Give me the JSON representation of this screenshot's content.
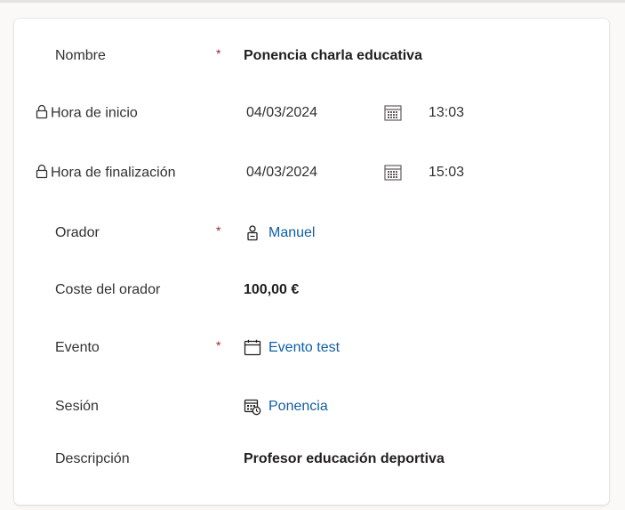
{
  "fields": {
    "nombre": {
      "label": "Nombre",
      "required_mark": "*",
      "value": "Ponencia charla educativa"
    },
    "hora_inicio": {
      "label": "Hora de inicio",
      "date": "04/03/2024",
      "time": "13:03"
    },
    "hora_fin": {
      "label": "Hora de finalización",
      "date": "04/03/2024",
      "time": "15:03"
    },
    "orador": {
      "label": "Orador",
      "required_mark": "*",
      "value": "Manuel"
    },
    "coste": {
      "label": "Coste del orador",
      "value": "100,00 €"
    },
    "evento": {
      "label": "Evento",
      "required_mark": "*",
      "value": "Evento test"
    },
    "sesion": {
      "label": "Sesión",
      "value": "Ponencia"
    },
    "descripcion": {
      "label": "Descripción",
      "value": "Profesor educación deportiva"
    }
  },
  "colors": {
    "required": "#a4262c",
    "link": "#115ea3",
    "label": "#323130"
  },
  "icons": [
    "lock-icon",
    "calendar-icon",
    "person-icon",
    "event-calendar-icon",
    "session-icon"
  ]
}
